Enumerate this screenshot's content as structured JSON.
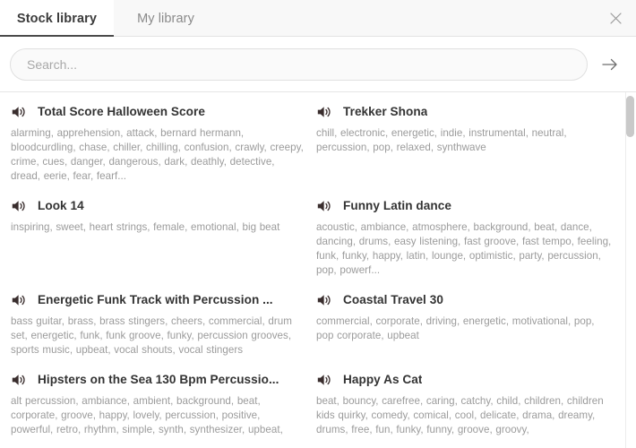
{
  "window": {
    "close_label": "×"
  },
  "tabs": [
    {
      "label": "Stock library",
      "active": true
    },
    {
      "label": "My library",
      "active": false
    }
  ],
  "search": {
    "placeholder": "Search...",
    "value": "",
    "submit_icon": "arrow-right-icon"
  },
  "results": {
    "left_column": [
      {
        "icon": "speaker-icon",
        "title": "Total Score Halloween Score",
        "tags": "alarming, apprehension, attack, bernard hermann, bloodcurdling, chase, chiller, chilling, confusion, crawly, creepy, crime, cues, danger, dangerous, dark, deathly, detective, dread, eerie, fear, fearf..."
      },
      {
        "icon": "speaker-icon",
        "title": "Look 14",
        "tags": "inspiring, sweet, heart strings, female, emotional, big beat"
      },
      {
        "icon": "speaker-icon",
        "title": "Energetic Funk Track with Percussion ...",
        "tags": "bass guitar, brass, brass stingers, cheers, commercial, drum set, energetic, funk, funk groove, funky, percussion grooves, sports music, upbeat, vocal shouts, vocal stingers"
      },
      {
        "icon": "speaker-icon",
        "title": "Hipsters on the Sea 130 Bpm Percussio...",
        "tags": "alt percussion, ambiance, ambient, background, beat, corporate, groove, happy, lovely, percussion, positive, powerful, retro, rhythm, simple, synth, synthesizer, upbeat,"
      }
    ],
    "right_column": [
      {
        "icon": "speaker-icon",
        "title": "Trekker Shona",
        "tags": "chill, electronic, energetic, indie, instrumental, neutral, percussion, pop, relaxed, synthwave"
      },
      {
        "icon": "speaker-icon",
        "title": "Funny Latin dance",
        "tags": "acoustic, ambiance, atmosphere, background, beat, dance, dancing, drums, easy listening, fast groove, fast tempo, feeling, funk, funky, happy, latin, lounge, optimistic, party, percussion, pop, powerf..."
      },
      {
        "icon": "speaker-icon",
        "title": "Coastal Travel 30",
        "tags": "commercial, corporate, driving, energetic, motivational, pop, pop corporate, upbeat"
      },
      {
        "icon": "speaker-icon",
        "title": "Happy As Cat",
        "tags": "beat, bouncy, carefree, caring, catchy, child, children, children kids quirky, comedy, comical, cool, delicate, drama, dreamy, drums, free, fun, funky, funny, groove, groovy,"
      }
    ]
  },
  "colors": {
    "header_bg": "#f8f8f8",
    "active_tab_underline": "#4a4a4a",
    "title_text": "#333333",
    "tag_text": "#9b9b9b",
    "scrollbar_thumb": "#c9c9c9"
  }
}
